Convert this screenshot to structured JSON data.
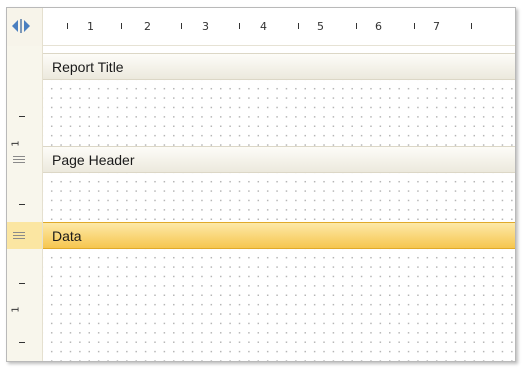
{
  "ruler": {
    "numbers": [
      "1",
      "2",
      "3",
      "4",
      "5",
      "6",
      "7"
    ],
    "vertical_number": "1"
  },
  "bands": [
    {
      "id": "report-title",
      "label": "Report Title",
      "selected": false
    },
    {
      "id": "page-header",
      "label": "Page Header",
      "selected": false
    },
    {
      "id": "data",
      "label": "Data",
      "selected": true
    }
  ],
  "colors": {
    "selected_band": "#f6c64f",
    "band_header": "#ece9dd",
    "ruler_background": "#f8f6ec"
  },
  "icons": {
    "corner": "ruler-toggle-icon",
    "grip": "band-grip-icon"
  }
}
